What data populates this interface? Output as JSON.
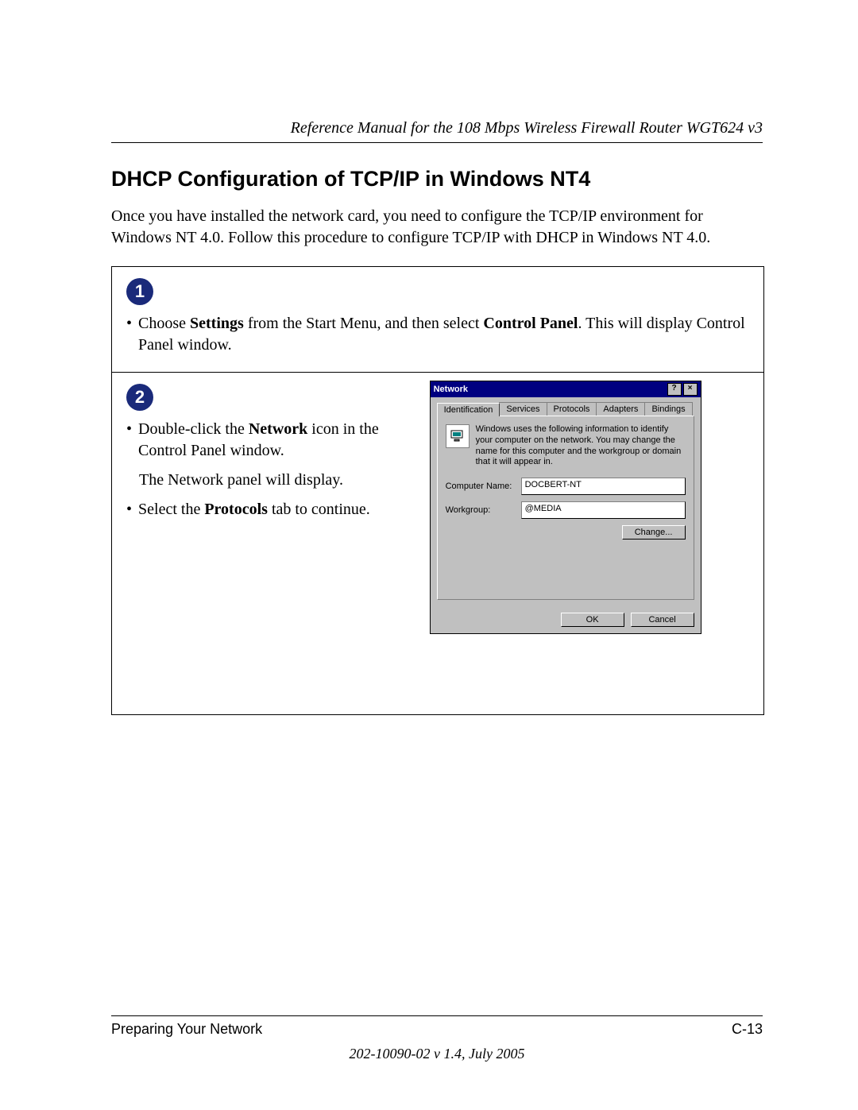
{
  "header": {
    "title": "Reference Manual for the 108 Mbps Wireless Firewall Router WGT624 v3"
  },
  "section": {
    "heading": "DHCP Configuration of TCP/IP in Windows NT4"
  },
  "intro": "Once you have installed the network card, you need to configure the TCP/IP environment for Windows NT 4.0. Follow this procedure to configure TCP/IP with DHCP in Windows NT 4.0.",
  "steps": {
    "s1": {
      "num": "1",
      "pre": "Choose ",
      "bold1": "Settings",
      "mid": " from the Start Menu, and then select ",
      "bold2": "Control Panel",
      "post": ". This will display Control Panel window."
    },
    "s2": {
      "num": "2",
      "b1a": "Double-click the ",
      "b1bold": "Network",
      "b1b": " icon in the Control Panel window.",
      "line": "The Network panel will display.",
      "b2a": "Select the ",
      "b2bold": "Protocols",
      "b2b": " tab to continue."
    }
  },
  "dialog": {
    "title": "Network",
    "help": "?",
    "close": "×",
    "tabs": {
      "t1": "Identification",
      "t2": "Services",
      "t3": "Protocols",
      "t4": "Adapters",
      "t5": "Bindings"
    },
    "desc": "Windows uses the following information to identify your computer on the network. You may change the name for this computer and the workgroup or domain that it will appear in.",
    "cn_label": "Computer Name:",
    "cn_value": "DOCBERT-NT",
    "wg_label": "Workgroup:",
    "wg_value": "@MEDIA",
    "change": "Change...",
    "ok": "OK",
    "cancel": "Cancel"
  },
  "footer": {
    "left": "Preparing Your Network",
    "right": "C-13",
    "docid": "202-10090-02 v 1.4, July 2005"
  }
}
